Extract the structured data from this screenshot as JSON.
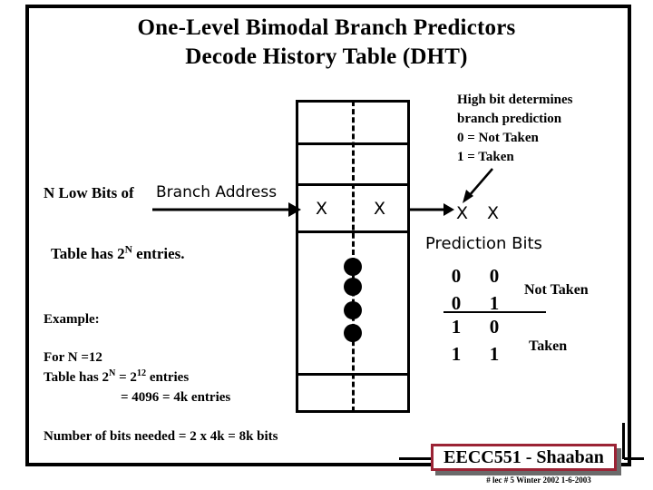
{
  "slide": {
    "title_line1": "One-Level Bimodal Branch Predictors",
    "title_line2": "Decode History Table (DHT)"
  },
  "diagram": {
    "input_label_bold": "N  Low Bits of",
    "input_label_thin": "Branch Address",
    "table_entries_note_pre": "Table has 2",
    "table_entries_note_sup": "N",
    "table_entries_note_post": " entries.",
    "cell_mark_left": "X",
    "cell_mark_right": "X",
    "ellipsis_dots": 4,
    "prediction_mark_left": "X",
    "prediction_mark_right": "X",
    "prediction_bits_label": "Prediction Bits"
  },
  "annotation": {
    "line1": "High bit determines",
    "line2": "branch prediction",
    "line3": "0  =  Not Taken",
    "line4": "1 =  Taken"
  },
  "bit_table": {
    "rows": [
      {
        "bit_a": "0",
        "bit_b": "0"
      },
      {
        "bit_a": "0",
        "bit_b": "1"
      },
      {
        "bit_a": "1",
        "bit_b": "0"
      },
      {
        "bit_a": "1",
        "bit_b": "1"
      }
    ],
    "outcome_not_taken": "Not Taken",
    "outcome_taken": "Taken"
  },
  "example": {
    "heading": "Example:",
    "line_for_n": "For  N =12",
    "line_table_has_pre": "Table  has     2",
    "line_table_has_sup1": "N",
    "line_table_has_mid": " =  2",
    "line_table_has_sup2": "12",
    "line_table_has_post": "  entries",
    "line_equals": "=  4096 =  4k entries",
    "line_bits_needed": "Number of bits needed =  2 x 4k = 8k bits"
  },
  "footer": {
    "badge": "EECC551 - Shaaban",
    "note": "#  lec # 5   Winter 2002   1-6-2003",
    "badge_border_color": "#9b2335"
  }
}
